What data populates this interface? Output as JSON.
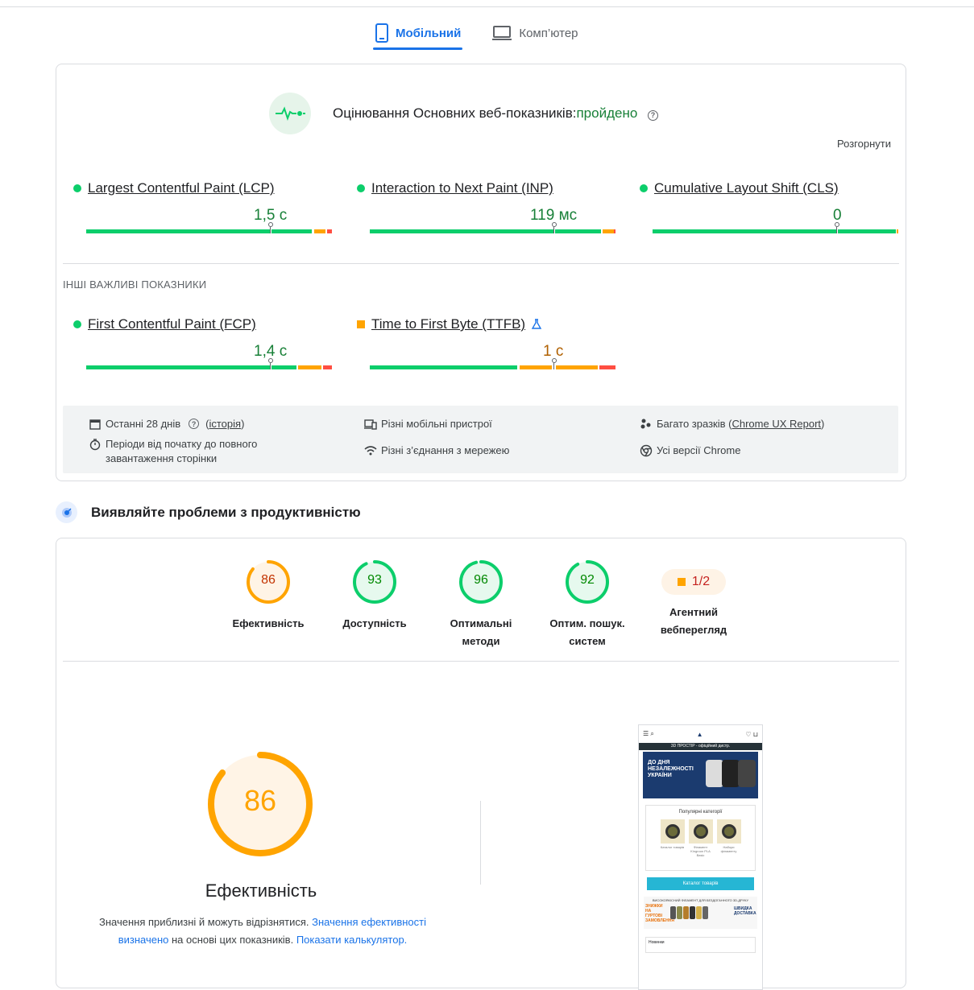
{
  "tabs": [
    {
      "label": "Мобільний",
      "icon": "smartphone-icon",
      "active": true
    },
    {
      "label": "Комп’ютер",
      "icon": "laptop-icon",
      "active": false
    }
  ],
  "cwv": {
    "title": "Оцінювання Основних веб-показників:",
    "status": "пройдено",
    "expand": "Розгорнути",
    "icon": "heartbeat-icon"
  },
  "core_metrics": [
    {
      "name": "Largest Contentful Paint (LCP)",
      "value": "1,5 с",
      "status": "good"
    },
    {
      "name": "Interaction to Next Paint (INP)",
      "value": "119 мс",
      "status": "good"
    },
    {
      "name": "Cumulative Layout Shift (CLS)",
      "value": "0",
      "status": "good"
    }
  ],
  "other_label": "ІНШІ ВАЖЛИВІ ПОКАЗНИКИ",
  "other_metrics": [
    {
      "name": "First Contentful Paint (FCP)",
      "value": "1,4 с",
      "status": "good"
    },
    {
      "name": "Time to First Byte (TTFB)",
      "value": "1 с",
      "status": "needs-improvement",
      "experimental_icon": "flask-icon"
    }
  ],
  "info": {
    "period": "Останні 28 днів",
    "history_link": "історія",
    "duration": "Періоди від початку до повного завантаження сторінки",
    "devices": "Різні мобільні пристрої",
    "connections": "Різні з’єднання з мережею",
    "samples_prefix": "Багато зразків (",
    "samples_link": "Chrome UX Report",
    "samples_suffix": ")",
    "chrome": "Усі версії Chrome"
  },
  "diagnose": {
    "title": "Виявляйте проблеми з продуктивністю"
  },
  "scores": [
    {
      "value": "86",
      "label": "Ефективність",
      "color": "#ffa400",
      "text_color": "#c33300",
      "fill": 0.86
    },
    {
      "value": "93",
      "label": "Доступність",
      "color": "#0cce6b",
      "text_color": "#008800",
      "fill": 0.93
    },
    {
      "value": "96",
      "label": "Оптимальні методи",
      "color": "#0cce6b",
      "text_color": "#008800",
      "fill": 0.96
    },
    {
      "value": "92",
      "label": "Оптим. пошук. систем",
      "color": "#0cce6b",
      "text_color": "#008800",
      "fill": 0.92
    }
  ],
  "agentic": {
    "value": "1/2",
    "label": "Агентний вебперегляд"
  },
  "perf": {
    "score": "86",
    "fill": 0.86,
    "label": "Ефективність",
    "note_1": "Значення приблизні й можуть відрізнятися. ",
    "note_link_1": "Значення ефективності визначено",
    "note_2": " на основі цих показників. ",
    "note_link_2": "Показати калькулятор."
  },
  "phone": {
    "strip": "3D ПРОСТІР - офіційний дистр.",
    "banner": "ДО ДНЯ НЕЗАЛЕЖНОСТІ УКРАЇНИ",
    "categories_title": "Популярні категорії",
    "thumb_labels": [
      "Каталог товарів",
      "Філамент Kingroon PLA Basic",
      "Набори філаменту"
    ],
    "catalog_button": "Каталог товарів",
    "promo_title": "ВИСОКОЯКІСНИЙ ФІЛАМЕНТ ДЛЯ БЕЗДОГАННОГО 3D-ДРУКУ",
    "promo_left": "ЗНИЖКИ НА ГУРТОВІ ЗАМОВЛЕННЯ",
    "promo_right": "ШВИДКА ДОСТАВКА",
    "bottom": "Новинки"
  }
}
